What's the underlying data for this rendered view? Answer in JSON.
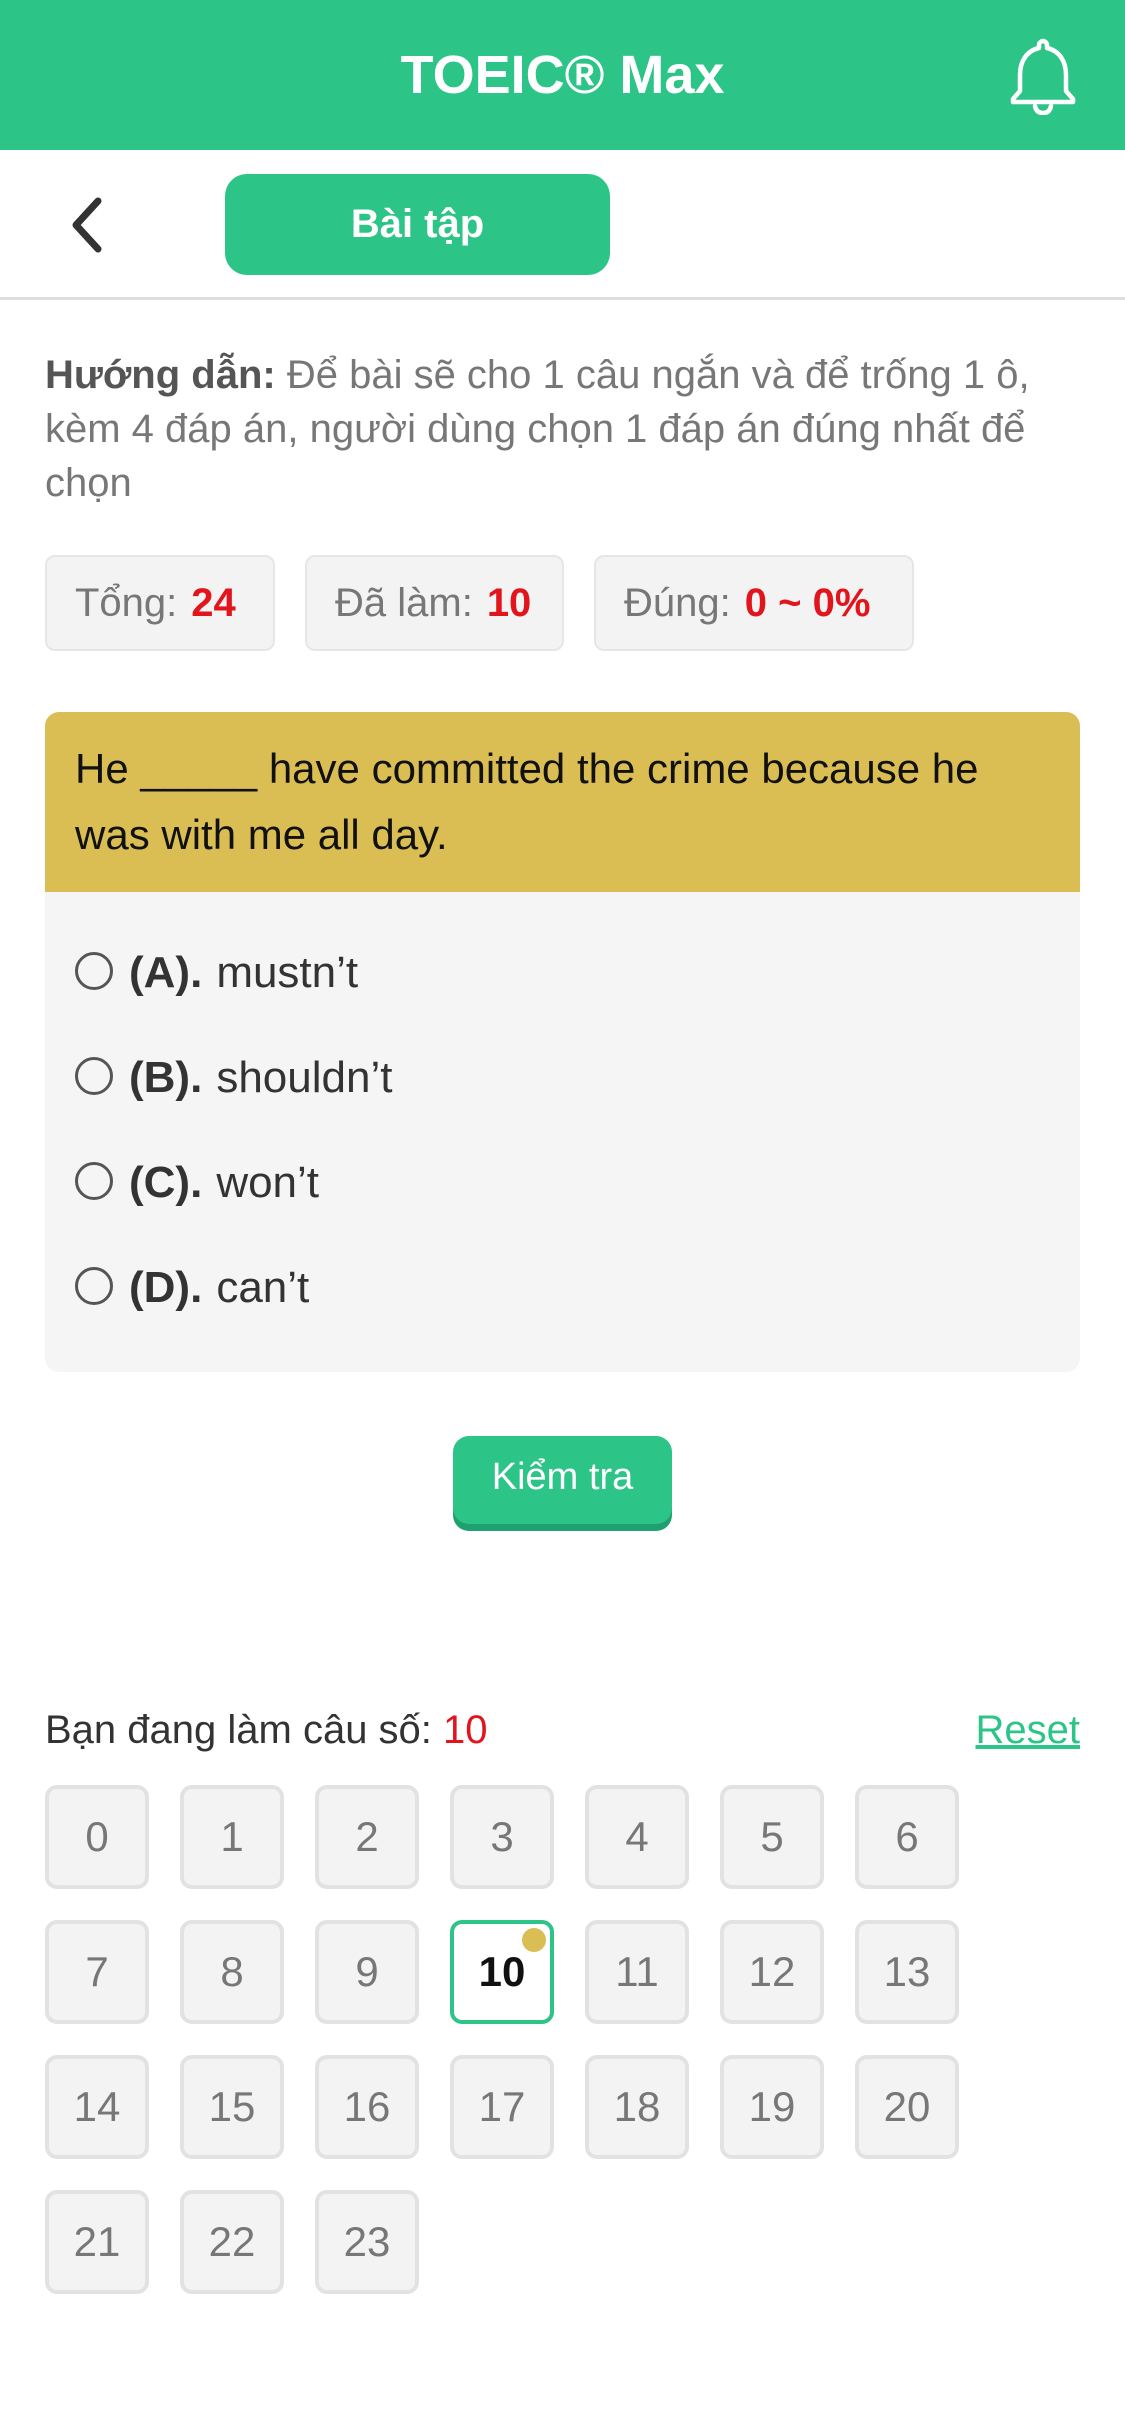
{
  "header": {
    "title": "TOEIC® Max",
    "icon": "bell-icon"
  },
  "subbar": {
    "back_icon": "chevron-left-icon",
    "tab_label": "Bài tập"
  },
  "guide": {
    "label": "Hướng dẫn:",
    "text": "Để bài sẽ cho 1 câu ngắn và để trống 1 ô, kèm 4 đáp án, người dùng chọn 1 đáp án đúng nhất để chọn"
  },
  "stats": {
    "total_label": "Tổng:",
    "total_value": "24",
    "done_label": "Đã làm:",
    "done_value": "10",
    "correct_label": "Đúng:",
    "correct_value": "0 ~ 0%"
  },
  "question": {
    "text": "He _____ have committed the crime because he was with me all day.",
    "options": [
      {
        "letter": "(A).",
        "text": "mustn’t"
      },
      {
        "letter": "(B).",
        "text": "shouldn’t"
      },
      {
        "letter": "(C).",
        "text": "won’t"
      },
      {
        "letter": "(D).",
        "text": "can’t"
      }
    ]
  },
  "check_label": "Kiểm tra",
  "progress": {
    "label": "Bạn đang làm câu số:",
    "current": "10",
    "reset_label": "Reset"
  },
  "numbers": [
    "0",
    "1",
    "2",
    "3",
    "4",
    "5",
    "6",
    "7",
    "8",
    "9",
    "10",
    "11",
    "12",
    "13",
    "14",
    "15",
    "16",
    "17",
    "18",
    "19",
    "20",
    "21",
    "22",
    "23"
  ],
  "colors": {
    "primary": "#2dc488",
    "question_bg": "#dbbe53",
    "highlight": "#e2141c"
  }
}
